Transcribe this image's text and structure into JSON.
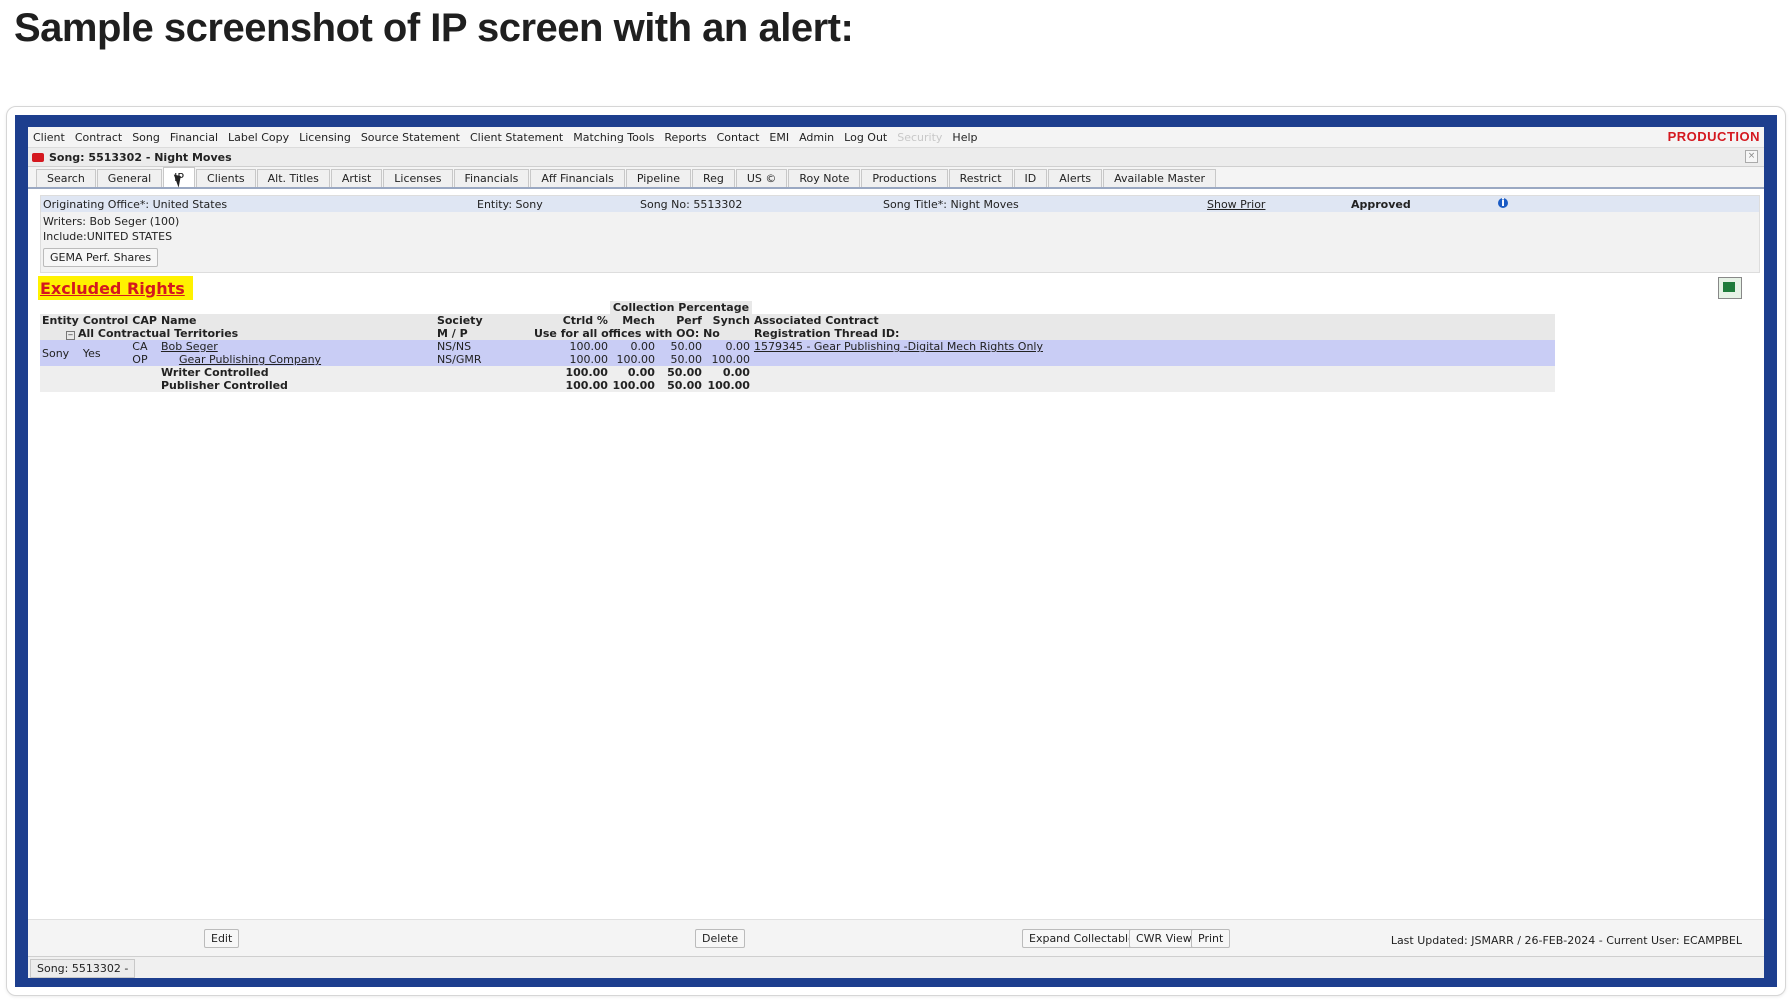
{
  "heading": "Sample screenshot of IP screen with an alert:",
  "menu": [
    "Client",
    "Contract",
    "Song",
    "Financial",
    "Label Copy",
    "Licensing",
    "Source Statement",
    "Client Statement",
    "Matching Tools",
    "Reports",
    "Contact",
    "EMI",
    "Admin",
    "Log Out",
    "Security",
    "Help"
  ],
  "environment": "PRODUCTION",
  "window_title": "Song: 5513302 - Night Moves",
  "close_glyph": "×",
  "tabs": [
    "Search",
    "General",
    "IP",
    "Clients",
    "Alt. Titles",
    "Artist",
    "Licenses",
    "Financials",
    "Aff Financials",
    "Pipeline",
    "Reg",
    "US ©",
    "Roy Note",
    "Productions",
    "Restrict",
    "ID",
    "Alerts",
    "Available Master"
  ],
  "info": {
    "originating_office": "Originating Office*: United States",
    "entity": "Entity: Sony",
    "song_no": "Song No: 5513302",
    "song_title": "Song Title*: Night Moves",
    "show_prior": "Show Prior",
    "status": "Approved",
    "info_glyph": "i",
    "writers": "Writers: Bob Seger (100)",
    "include": "Include:UNITED STATES",
    "gema_button": "GEMA Perf. Shares"
  },
  "alert": "Excluded Rights",
  "table": {
    "group_header": "Collection Percentage",
    "headers": {
      "entity": "Entity",
      "control": "Control",
      "cap": "CAP",
      "name": "Name",
      "society": "Society",
      "ctrld": "Ctrld %",
      "mech": "Mech",
      "perf": "Perf",
      "synch": "Synch",
      "contract": "Associated Contract"
    },
    "territory": "All Contractual Territories",
    "mp": "M / P",
    "use_all": "Use for all offices with OO: No",
    "reg_thread": "Registration Thread ID:",
    "row_entity": "Sony",
    "row_control": "Yes",
    "rows": [
      {
        "cap": "CA",
        "name": "Bob Seger",
        "society": "NS/NS",
        "ctrld": "100.00",
        "mech": "0.00",
        "perf": "50.00",
        "synch": "0.00",
        "contract": "1579345 - Gear Publishing -Digital Mech Rights Only"
      },
      {
        "cap": "OP",
        "name": "Gear Publishing Company",
        "society": "NS/GMR",
        "ctrld": "100.00",
        "mech": "100.00",
        "perf": "50.00",
        "synch": "100.00",
        "contract": ""
      }
    ],
    "totals": [
      {
        "label": "Writer Controlled",
        "ctrld": "100.00",
        "mech": "0.00",
        "perf": "50.00",
        "synch": "0.00"
      },
      {
        "label": "Publisher Controlled",
        "ctrld": "100.00",
        "mech": "100.00",
        "perf": "50.00",
        "synch": "100.00"
      }
    ]
  },
  "buttons": {
    "edit": "Edit",
    "delete": "Delete",
    "expand": "Expand Collectables",
    "cwr": "CWR View",
    "print": "Print"
  },
  "last_updated": "Last Updated: JSMARR / 26-FEB-2024 - Current User: ECAMPBEL",
  "status_tab": "Song: 5513302 -"
}
